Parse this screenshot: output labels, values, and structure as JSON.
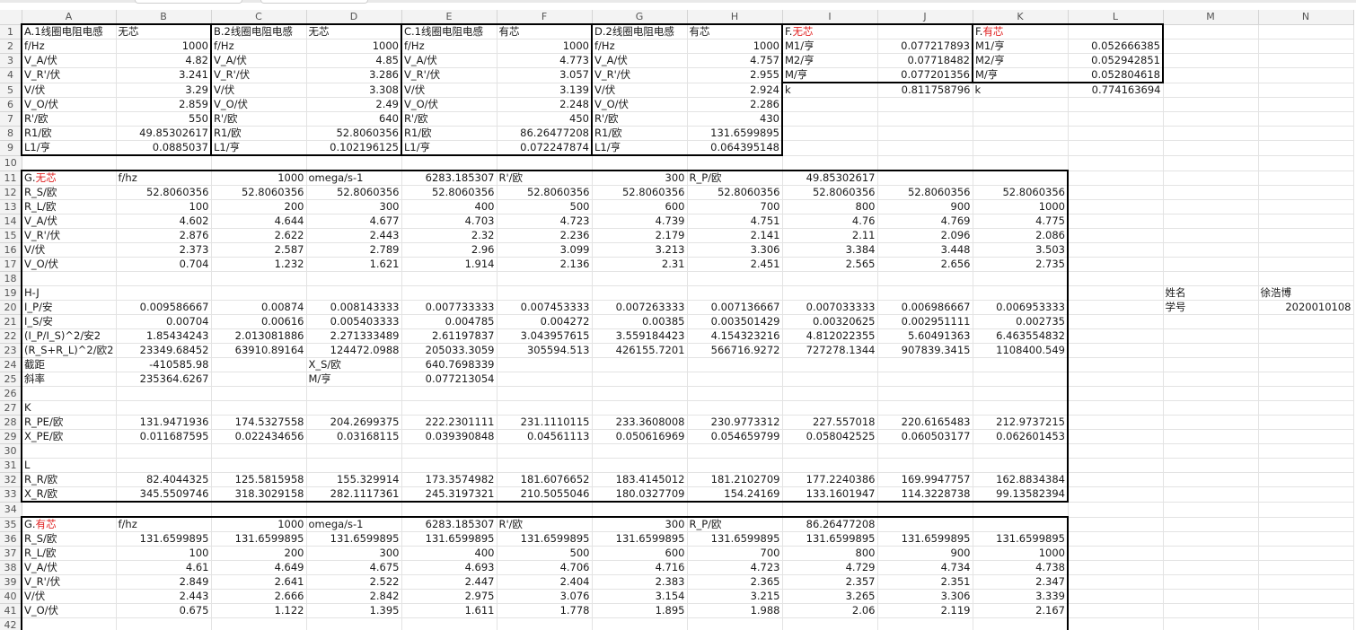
{
  "columns": [
    "A",
    "B",
    "C",
    "D",
    "E",
    "F",
    "G",
    "H",
    "I",
    "J",
    "K",
    "L",
    "M",
    "N"
  ],
  "rows": [
    {
      "n": "1",
      "c": [
        "A.1线圈电阻电感",
        "无芯",
        "B.2线圈电阻电感",
        "无芯",
        "C.1线圈电阻电感",
        "有芯",
        "D.2线圈电阻电感",
        "有芯",
        "F.无芯",
        "",
        "F.有芯",
        "",
        "",
        ""
      ]
    },
    {
      "n": "2",
      "c": [
        "f/Hz",
        "1000",
        "f/Hz",
        "1000",
        "f/Hz",
        "1000",
        "f/Hz",
        "1000",
        "M1/亨",
        "0.077217893",
        "M1/亨",
        "0.052666385",
        "",
        ""
      ]
    },
    {
      "n": "3",
      "c": [
        "V_A/伏",
        "4.82",
        "V_A/伏",
        "4.85",
        "V_A/伏",
        "4.773",
        "V_A/伏",
        "4.757",
        "M2/亨",
        "0.07718482",
        "M2/亨",
        "0.052942851",
        "",
        ""
      ]
    },
    {
      "n": "4",
      "c": [
        "V_R'/伏",
        "3.241",
        "V_R'/伏",
        "3.286",
        "V_R'/伏",
        "3.057",
        "V_R'/伏",
        "2.955",
        "M/亨",
        "0.077201356",
        "M/亨",
        "0.052804618",
        "",
        ""
      ]
    },
    {
      "n": "5",
      "c": [
        "V/伏",
        "3.29",
        "V/伏",
        "3.308",
        "V/伏",
        "3.139",
        "V/伏",
        "2.924",
        "k",
        "0.811758796",
        "k",
        "0.774163694",
        "",
        ""
      ]
    },
    {
      "n": "6",
      "c": [
        "V_O/伏",
        "2.859",
        "V_O/伏",
        "2.49",
        "V_O/伏",
        "2.248",
        "V_O/伏",
        "2.286",
        "",
        "",
        "",
        "",
        "",
        ""
      ]
    },
    {
      "n": "7",
      "c": [
        "R'/欧",
        "550",
        "R'/欧",
        "640",
        "R'/欧",
        "450",
        "R'/欧",
        "430",
        "",
        "",
        "",
        "",
        "",
        ""
      ]
    },
    {
      "n": "8",
      "c": [
        "R1/欧",
        "49.85302617",
        "R1/欧",
        "52.8060356",
        "R1/欧",
        "86.26477208",
        "R1/欧",
        "131.6599895",
        "",
        "",
        "",
        "",
        "",
        ""
      ]
    },
    {
      "n": "9",
      "c": [
        "L1/亨",
        "0.0885037",
        "L1/亨",
        "0.102196125",
        "L1/亨",
        "0.072247874",
        "L1/亨",
        "0.064395148",
        "",
        "",
        "",
        "",
        "",
        ""
      ]
    },
    {
      "n": "10",
      "c": [
        "",
        "",
        "",
        "",
        "",
        "",
        "",
        "",
        "",
        "",
        "",
        "",
        "",
        ""
      ]
    },
    {
      "n": "11",
      "c": [
        "G.无芯",
        "f/hz",
        "1000",
        "omega/s-1",
        "6283.185307",
        "R'/欧",
        "300",
        "R_P/欧",
        "49.85302617",
        "",
        "",
        "",
        "",
        ""
      ]
    },
    {
      "n": "12",
      "c": [
        "R_S/欧",
        "52.8060356",
        "52.8060356",
        "52.8060356",
        "52.8060356",
        "52.8060356",
        "52.8060356",
        "52.8060356",
        "52.8060356",
        "52.8060356",
        "52.8060356",
        "",
        "",
        ""
      ]
    },
    {
      "n": "13",
      "c": [
        "R_L/欧",
        "100",
        "200",
        "300",
        "400",
        "500",
        "600",
        "700",
        "800",
        "900",
        "1000",
        "",
        "",
        ""
      ]
    },
    {
      "n": "14",
      "c": [
        "V_A/伏",
        "4.602",
        "4.644",
        "4.677",
        "4.703",
        "4.723",
        "4.739",
        "4.751",
        "4.76",
        "4.769",
        "4.775",
        "",
        "",
        ""
      ]
    },
    {
      "n": "15",
      "c": [
        "V_R'/伏",
        "2.876",
        "2.622",
        "2.443",
        "2.32",
        "2.236",
        "2.179",
        "2.141",
        "2.11",
        "2.096",
        "2.086",
        "",
        "",
        ""
      ]
    },
    {
      "n": "16",
      "c": [
        "V/伏",
        "2.373",
        "2.587",
        "2.789",
        "2.96",
        "3.099",
        "3.213",
        "3.306",
        "3.384",
        "3.448",
        "3.503",
        "",
        "",
        ""
      ]
    },
    {
      "n": "17",
      "c": [
        "V_O/伏",
        "0.704",
        "1.232",
        "1.621",
        "1.914",
        "2.136",
        "2.31",
        "2.451",
        "2.565",
        "2.656",
        "2.735",
        "",
        "",
        ""
      ]
    },
    {
      "n": "18",
      "c": [
        "",
        "",
        "",
        "",
        "",
        "",
        "",
        "",
        "",
        "",
        "",
        "",
        "",
        ""
      ]
    },
    {
      "n": "19",
      "c": [
        "H-J",
        "",
        "",
        "",
        "",
        "",
        "",
        "",
        "",
        "",
        "",
        "",
        "姓名",
        "徐浩博"
      ]
    },
    {
      "n": "20",
      "c": [
        "I_P/安",
        "0.009586667",
        "0.00874",
        "0.008143333",
        "0.007733333",
        "0.007453333",
        "0.007263333",
        "0.007136667",
        "0.007033333",
        "0.006986667",
        "0.006953333",
        "",
        "学号",
        "2020010108"
      ]
    },
    {
      "n": "21",
      "c": [
        "I_S/安",
        "0.00704",
        "0.00616",
        "0.005403333",
        "0.004785",
        "0.004272",
        "0.00385",
        "0.003501429",
        "0.00320625",
        "0.002951111",
        "0.002735",
        "",
        "",
        ""
      ]
    },
    {
      "n": "22",
      "c": [
        "(I_P/I_S)^2/安2",
        "1.85434243",
        "2.013081886",
        "2.271333489",
        "2.61197837",
        "3.043957615",
        "3.559184423",
        "4.154323216",
        "4.812022355",
        "5.60491363",
        "6.463554832",
        "",
        "",
        ""
      ]
    },
    {
      "n": "23",
      "c": [
        "(R_S+R_L)^2/欧2",
        "23349.68452",
        "63910.89164",
        "124472.0988",
        "205033.3059",
        "305594.513",
        "426155.7201",
        "566716.9272",
        "727278.1344",
        "907839.3415",
        "1108400.549",
        "",
        "",
        ""
      ]
    },
    {
      "n": "24",
      "c": [
        "截距",
        "-410585.98",
        "",
        "X_S/欧",
        "640.7698339",
        "",
        "",
        "",
        "",
        "",
        "",
        "",
        "",
        ""
      ]
    },
    {
      "n": "25",
      "c": [
        "斜率",
        "235364.6267",
        "",
        "M/亨",
        "0.077213054",
        "",
        "",
        "",
        "",
        "",
        "",
        "",
        "",
        ""
      ]
    },
    {
      "n": "26",
      "c": [
        "",
        "",
        "",
        "",
        "",
        "",
        "",
        "",
        "",
        "",
        "",
        "",
        "",
        ""
      ]
    },
    {
      "n": "27",
      "c": [
        "K",
        "",
        "",
        "",
        "",
        "",
        "",
        "",
        "",
        "",
        "",
        "",
        "",
        ""
      ]
    },
    {
      "n": "28",
      "c": [
        "R_PE/欧",
        "131.9471936",
        "174.5327558",
        "204.2699375",
        "222.2301111",
        "231.1110115",
        "233.3608008",
        "230.9773312",
        "227.557018",
        "220.6165483",
        "212.9737215",
        "",
        "",
        ""
      ]
    },
    {
      "n": "29",
      "c": [
        "X_PE/欧",
        "0.011687595",
        "0.022434656",
        "0.03168115",
        "0.039390848",
        "0.04561113",
        "0.050616969",
        "0.054659799",
        "0.058042525",
        "0.060503177",
        "0.062601453",
        "",
        "",
        ""
      ]
    },
    {
      "n": "30",
      "c": [
        "",
        "",
        "",
        "",
        "",
        "",
        "",
        "",
        "",
        "",
        "",
        "",
        "",
        ""
      ]
    },
    {
      "n": "31",
      "c": [
        "L",
        "",
        "",
        "",
        "",
        "",
        "",
        "",
        "",
        "",
        "",
        "",
        "",
        ""
      ]
    },
    {
      "n": "32",
      "c": [
        "R_R/欧",
        "82.4044325",
        "125.5815958",
        "155.329914",
        "173.3574982",
        "181.6076652",
        "183.4145012",
        "181.2102709",
        "177.2240386",
        "169.9947757",
        "162.8834384",
        "",
        "",
        ""
      ]
    },
    {
      "n": "33",
      "c": [
        "X_R/欧",
        "345.5509746",
        "318.3029158",
        "282.1117361",
        "245.3197321",
        "210.5055046",
        "180.0327709",
        "154.24169",
        "133.1601947",
        "114.3228738",
        "99.13582394",
        "",
        "",
        ""
      ]
    },
    {
      "n": "34",
      "c": [
        "",
        "",
        "",
        "",
        "",
        "",
        "",
        "",
        "",
        "",
        "",
        "",
        "",
        ""
      ]
    },
    {
      "n": "35",
      "c": [
        "G.有芯",
        "f/hz",
        "1000",
        "omega/s-1",
        "6283.185307",
        "R'/欧",
        "300",
        "R_P/欧",
        "86.26477208",
        "",
        "",
        "",
        "",
        ""
      ]
    },
    {
      "n": "36",
      "c": [
        "R_S/欧",
        "131.6599895",
        "131.6599895",
        "131.6599895",
        "131.6599895",
        "131.6599895",
        "131.6599895",
        "131.6599895",
        "131.6599895",
        "131.6599895",
        "131.6599895",
        "",
        "",
        ""
      ]
    },
    {
      "n": "37",
      "c": [
        "R_L/欧",
        "100",
        "200",
        "300",
        "400",
        "500",
        "600",
        "700",
        "800",
        "900",
        "1000",
        "",
        "",
        ""
      ]
    },
    {
      "n": "38",
      "c": [
        "V_A/伏",
        "4.61",
        "4.649",
        "4.675",
        "4.693",
        "4.706",
        "4.716",
        "4.723",
        "4.729",
        "4.734",
        "4.738",
        "",
        "",
        ""
      ]
    },
    {
      "n": "39",
      "c": [
        "V_R'/伏",
        "2.849",
        "2.641",
        "2.522",
        "2.447",
        "2.404",
        "2.383",
        "2.365",
        "2.357",
        "2.351",
        "2.347",
        "",
        "",
        ""
      ]
    },
    {
      "n": "40",
      "c": [
        "V/伏",
        "2.443",
        "2.666",
        "2.842",
        "2.975",
        "3.076",
        "3.154",
        "3.215",
        "3.265",
        "3.306",
        "3.339",
        "",
        "",
        ""
      ]
    },
    {
      "n": "41",
      "c": [
        "V_O/伏",
        "0.675",
        "1.122",
        "1.395",
        "1.611",
        "1.778",
        "1.895",
        "1.988",
        "2.06",
        "2.119",
        "2.167",
        "",
        "",
        ""
      ]
    },
    {
      "n": "42",
      "c": [
        "",
        "",
        "",
        "",
        "",
        "",
        "",
        "",
        "",
        "",
        "",
        "",
        "",
        ""
      ]
    }
  ],
  "colors": {
    "red_text": "#e02020",
    "header_bg": "#f3f3f3",
    "grid": "#e3e3e3",
    "border": "#000000"
  }
}
